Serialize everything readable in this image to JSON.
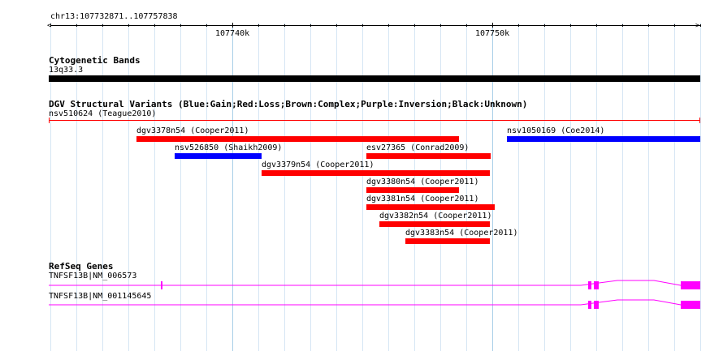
{
  "ruler": {
    "location": "chr13:107732871..107757838",
    "tick_labels": [
      {
        "label": "107740k",
        "bp": 107740000
      },
      {
        "label": "107750k",
        "bp": 107750000
      }
    ]
  },
  "cytoband": {
    "title": "Cytogenetic Bands",
    "band_label": "13q33.3",
    "color": "#000000"
  },
  "dgv": {
    "title": "DGV Structural Variants (Blue:Gain;Red:Loss;Brown:Complex;Purple:Inversion;Black:Unknown)",
    "variants": [
      {
        "label": "nsv510624 (Teague2010)",
        "type": "loss",
        "color": "#ff0000"
      },
      {
        "label": "dgv3378n54 (Cooper2011)",
        "type": "loss",
        "color": "#ff0000"
      },
      {
        "label": "nsv1050169 (Coe2014)",
        "type": "gain",
        "color": "#0000ff"
      },
      {
        "label": "nsv526850 (Shaikh2009)",
        "type": "gain",
        "color": "#0000ff"
      },
      {
        "label": "esv27365 (Conrad2009)",
        "type": "loss",
        "color": "#ff0000"
      },
      {
        "label": "dgv3379n54 (Cooper2011)",
        "type": "loss",
        "color": "#ff0000"
      },
      {
        "label": "dgv3380n54 (Cooper2011)",
        "type": "loss",
        "color": "#ff0000"
      },
      {
        "label": "dgv3381n54 (Cooper2011)",
        "type": "loss",
        "color": "#ff0000"
      },
      {
        "label": "dgv3382n54 (Cooper2011)",
        "type": "loss",
        "color": "#ff0000"
      },
      {
        "label": "dgv3383n54 (Cooper2011)",
        "type": "loss",
        "color": "#ff0000"
      }
    ]
  },
  "refseq": {
    "title": "RefSeq Genes",
    "color": "#ff00ff",
    "genes": [
      {
        "label": "TNFSF13B|NM_006573"
      },
      {
        "label": "TNFSF13B|NM_001145645"
      }
    ]
  }
}
